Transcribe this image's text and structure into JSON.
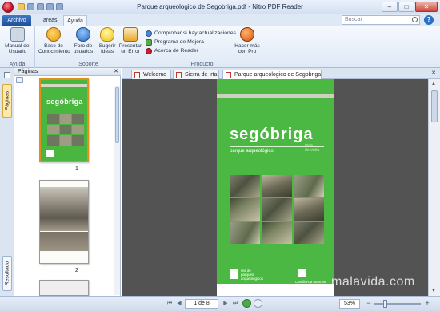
{
  "window": {
    "title": "Parque arqueologico de Segobriga.pdf - Nitro PDF Reader"
  },
  "tabs": [
    {
      "label": "Archivo"
    },
    {
      "label": "Tareas"
    },
    {
      "label": "Ayuda"
    }
  ],
  "search": {
    "placeholder": "Buscar"
  },
  "ribbon": {
    "groups": [
      {
        "label": "Ayuda",
        "buttons": [
          {
            "label": "Manual del Usuario",
            "icon": "book-icon"
          }
        ]
      },
      {
        "label": "Soporte",
        "buttons": [
          {
            "label": "Base de Conocimiento",
            "icon": "globe-icon"
          },
          {
            "label": "Foro de usuarios",
            "icon": "users-icon"
          },
          {
            "label": "Sugerir Ideas",
            "icon": "bulb-icon"
          },
          {
            "label": "Presentar un Error",
            "icon": "warning-icon"
          }
        ]
      },
      {
        "label": "Producto",
        "items": [
          {
            "label": "Comprobar si hay actualizaciones",
            "icon": "update-icon"
          },
          {
            "label": "Programa de Mejora",
            "icon": "program-icon"
          },
          {
            "label": "Acerca de Reader",
            "icon": "about-icon"
          }
        ],
        "pro_button": {
          "label": "Hacer más con Pro",
          "icon": "nitro-icon"
        }
      }
    ]
  },
  "side_panel": {
    "vertical_tabs": {
      "pages": "Páginas",
      "results": "Resultado"
    },
    "header": "Páginas",
    "thumbnails": [
      {
        "number": "1",
        "cover_title": "segóbriga"
      },
      {
        "number": "2"
      }
    ]
  },
  "document_tabs": [
    {
      "label": "Welcome"
    },
    {
      "label": "Sierra de Irta"
    },
    {
      "label": "Parque arqueologico de Segobriga"
    }
  ],
  "document": {
    "cover_title": "segóbriga",
    "cover_subtitle": "parque arqueológico",
    "side_text": "guía\nde visita",
    "footer_text": "red de\nparques\narqueológicos",
    "footer_right": "Castilla-La Mancha"
  },
  "statusbar": {
    "page_indicator": "1 de 8",
    "zoom": "53%",
    "zoom_level": 0.53
  },
  "watermark": "malavida.com"
}
